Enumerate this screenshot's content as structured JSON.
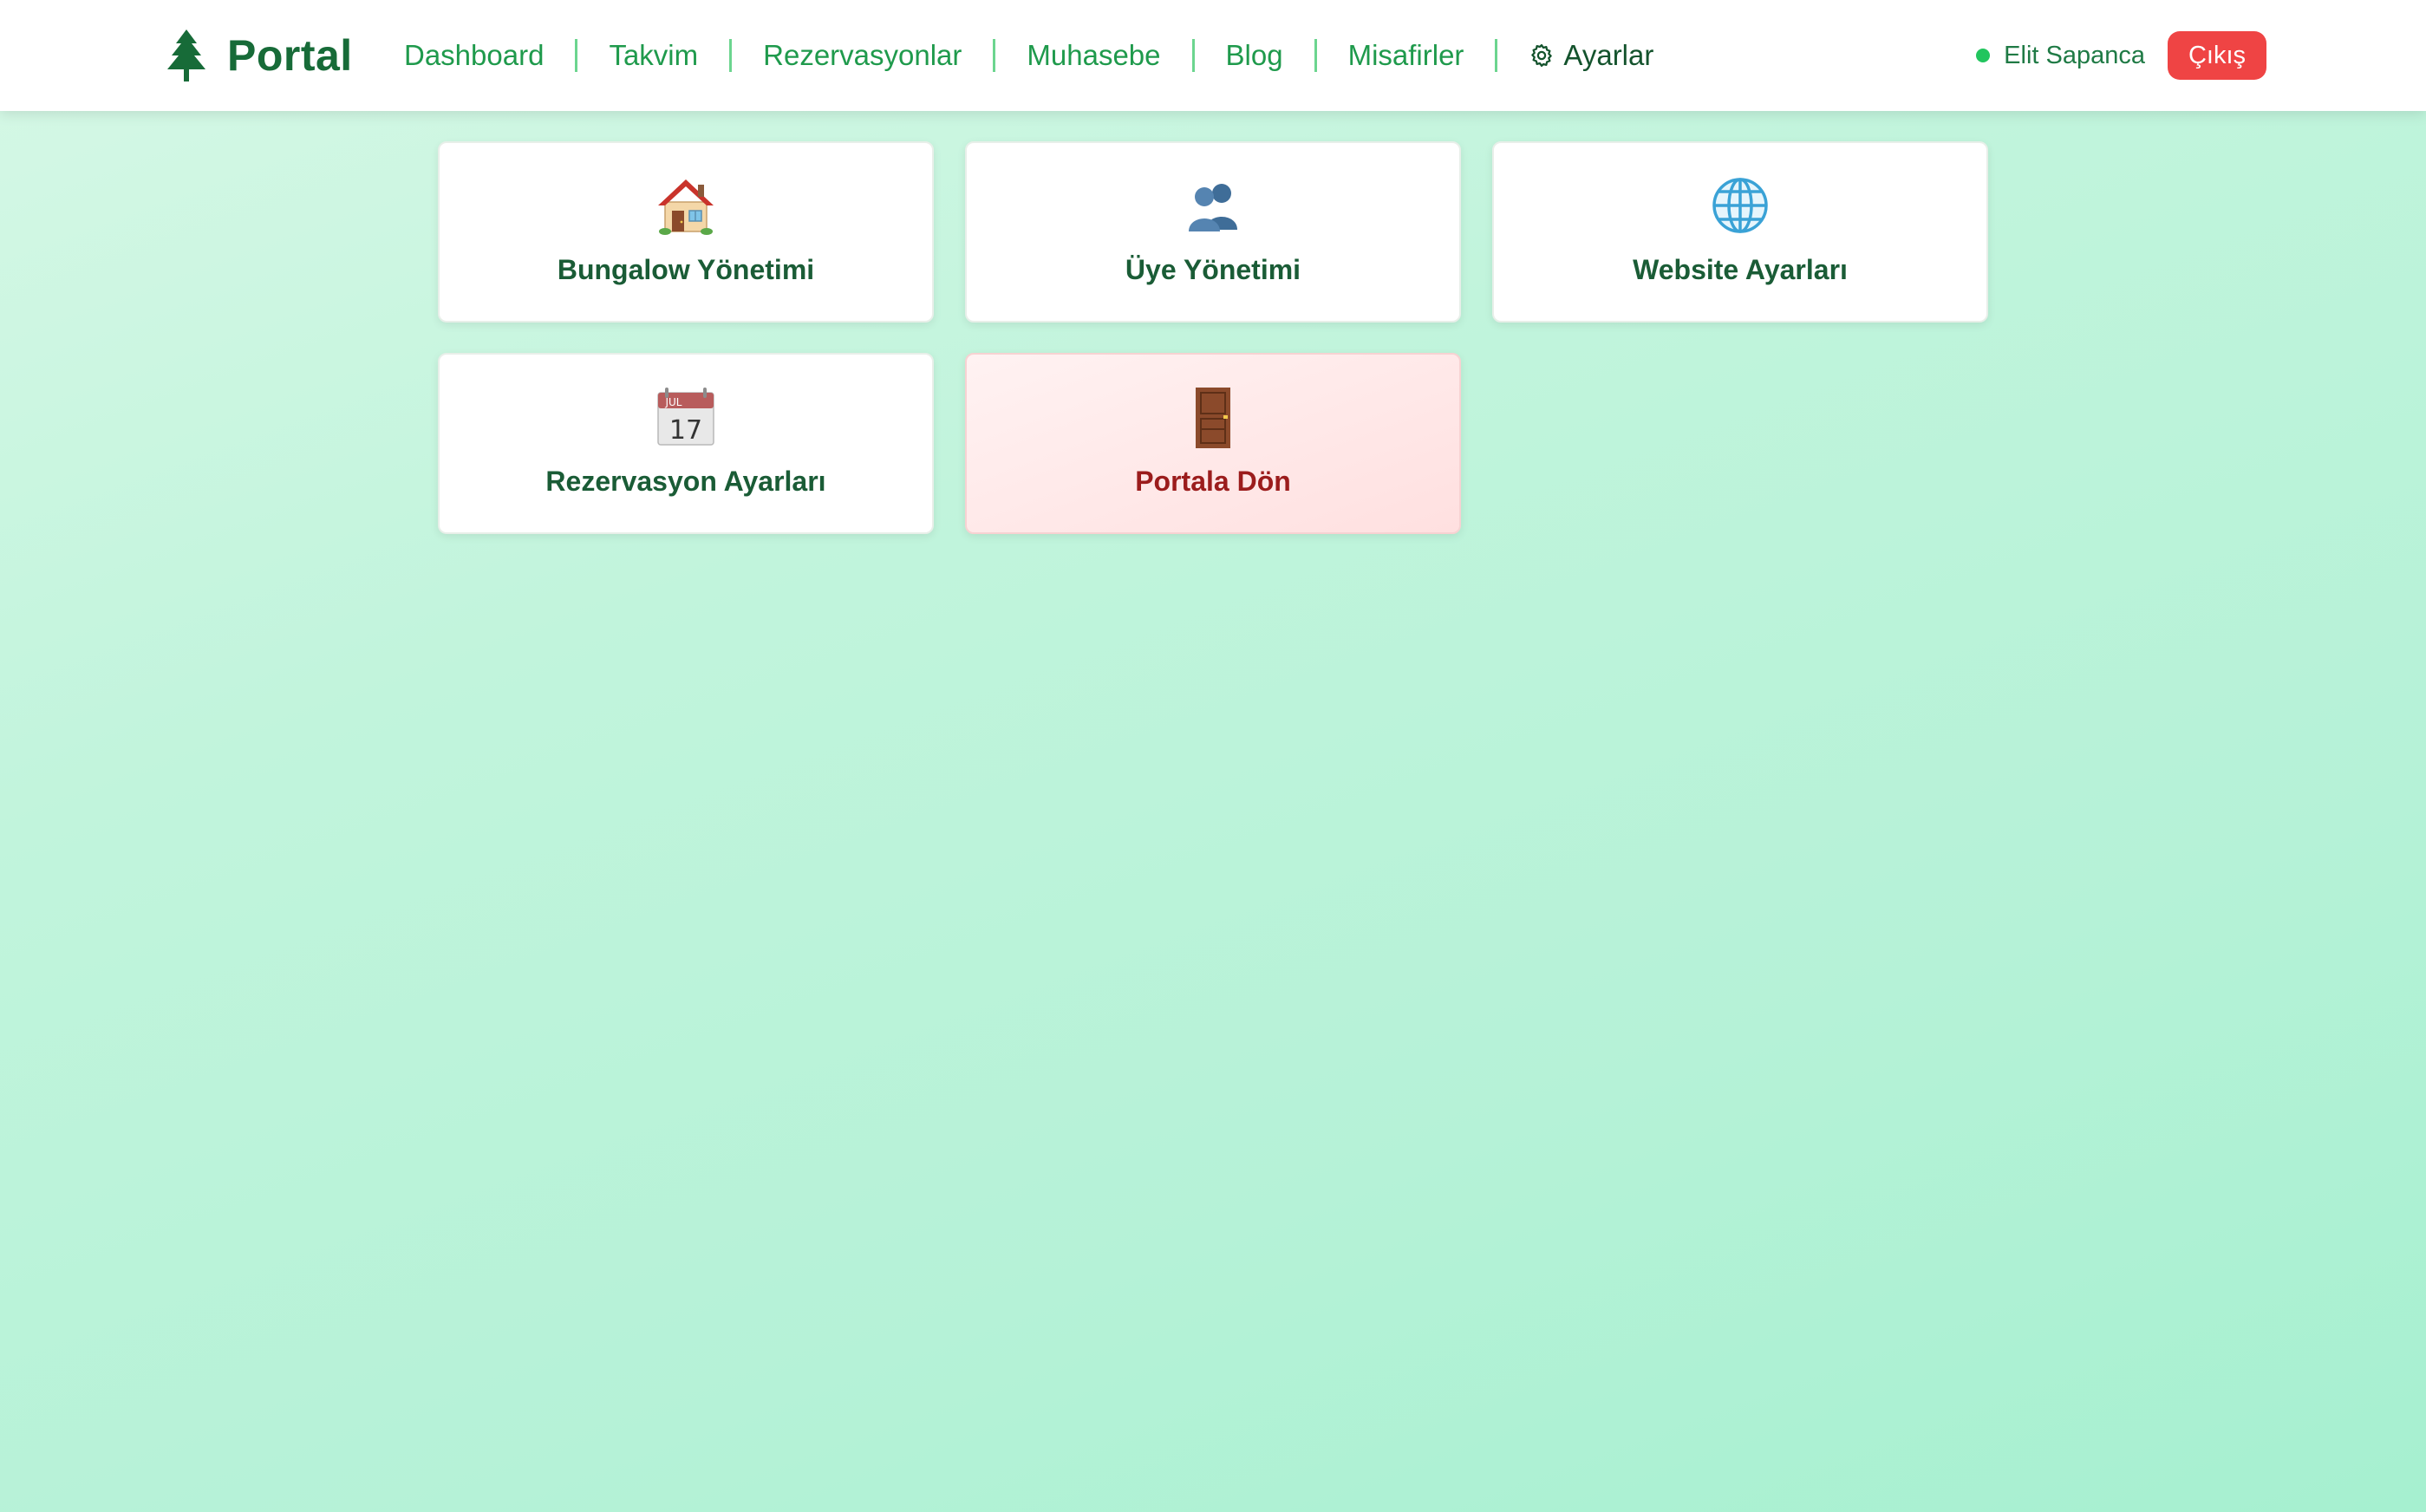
{
  "header": {
    "brand_icon": "pine-tree-icon",
    "brand_name": "Portal",
    "nav": [
      {
        "label": "Dashboard"
      },
      {
        "label": "Takvim"
      },
      {
        "label": "Rezervasyonlar"
      },
      {
        "label": "Muhasebe"
      },
      {
        "label": "Blog"
      },
      {
        "label": "Misafirler"
      },
      {
        "label": "Ayarlar",
        "icon": "gear-icon",
        "active": true
      }
    ],
    "user": {
      "status": "online",
      "status_color": "#22c55e",
      "name": "Elit Sapanca"
    },
    "logout_label": "Çıkış",
    "logout_color": "#ef4444"
  },
  "cards": [
    {
      "label": "Bungalow Yönetimi",
      "icon": "house-icon"
    },
    {
      "label": "Üye Yönetimi",
      "icon": "users-icon"
    },
    {
      "label": "Website Ayarları",
      "icon": "globe-icon"
    },
    {
      "label": "Rezervasyon Ayarları",
      "icon": "calendar-icon",
      "icon_month": "JUL",
      "icon_day": "17"
    },
    {
      "label": "Portala Dön",
      "icon": "door-icon",
      "variant": "danger"
    }
  ],
  "colors": {
    "brand": "#176b38",
    "nav_link": "#1f9a4c",
    "danger_text": "#9b1c1c"
  }
}
